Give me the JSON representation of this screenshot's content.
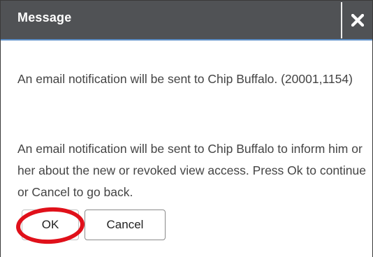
{
  "dialog": {
    "title": "Message",
    "close_icon": "close-icon",
    "paragraphs": [
      "An email notification will be sent to Chip Buffalo. (20001,1154)",
      "An email notification will be sent to Chip Buffalo to inform him or her about the new or revoked view access. Press Ok to continue or Cancel to go back."
    ],
    "buttons": {
      "ok_label": "OK",
      "cancel_label": "Cancel"
    }
  },
  "colors": {
    "titlebar": "#505255",
    "accent": "#5c8fc8",
    "highlight": "#e0101a",
    "body_text": "#444444"
  }
}
